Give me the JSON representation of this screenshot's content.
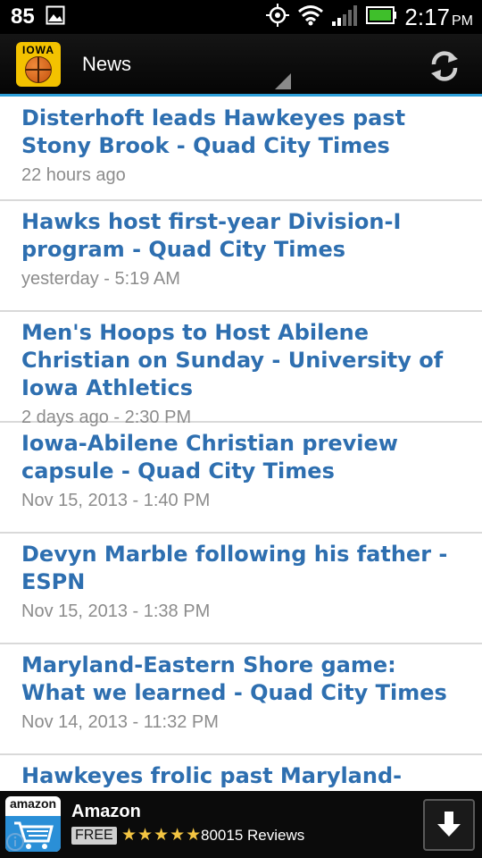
{
  "status_bar": {
    "notification_count": "85",
    "time": "2:17",
    "ampm": "PM",
    "icons": [
      "image-icon",
      "gps-icon",
      "wifi-icon",
      "signal-icon",
      "battery-icon"
    ]
  },
  "action_bar": {
    "logo_text": "IOWA",
    "title": "News",
    "accent_color": "#2d9fd9"
  },
  "news": [
    {
      "title": "Disterhoft leads Hawkeyes past Stony Brook - Quad City Times",
      "time": "22 hours ago"
    },
    {
      "title": "Hawks host first-year Division-I program - Quad City Times",
      "time": "yesterday - 5:19 AM"
    },
    {
      "title": "Men's Hoops to Host Abilene Christian on Sunday - University of Iowa Athletics",
      "time": "2 days ago - 2:30 PM"
    },
    {
      "title": "Iowa-Abilene Christian preview capsule - Quad City Times",
      "time": "Nov 15, 2013 - 1:40 PM"
    },
    {
      "title": "Devyn Marble following his father - ESPN",
      "time": "Nov 15, 2013 - 1:38 PM"
    },
    {
      "title": "Maryland-Eastern Shore game: What we learned - Quad City Times",
      "time": "Nov 14, 2013 - 11:32 PM"
    },
    {
      "title": "Hawkeyes frolic past Maryland-Eastern",
      "time": ""
    }
  ],
  "ad": {
    "logo_text": "amazon",
    "title": "Amazon",
    "free_label": "FREE",
    "stars": "★★★★★",
    "reviews": "80015 Reviews"
  },
  "colors": {
    "title_blue": "#2e6fb0",
    "time_gray": "#8c8c8c"
  }
}
